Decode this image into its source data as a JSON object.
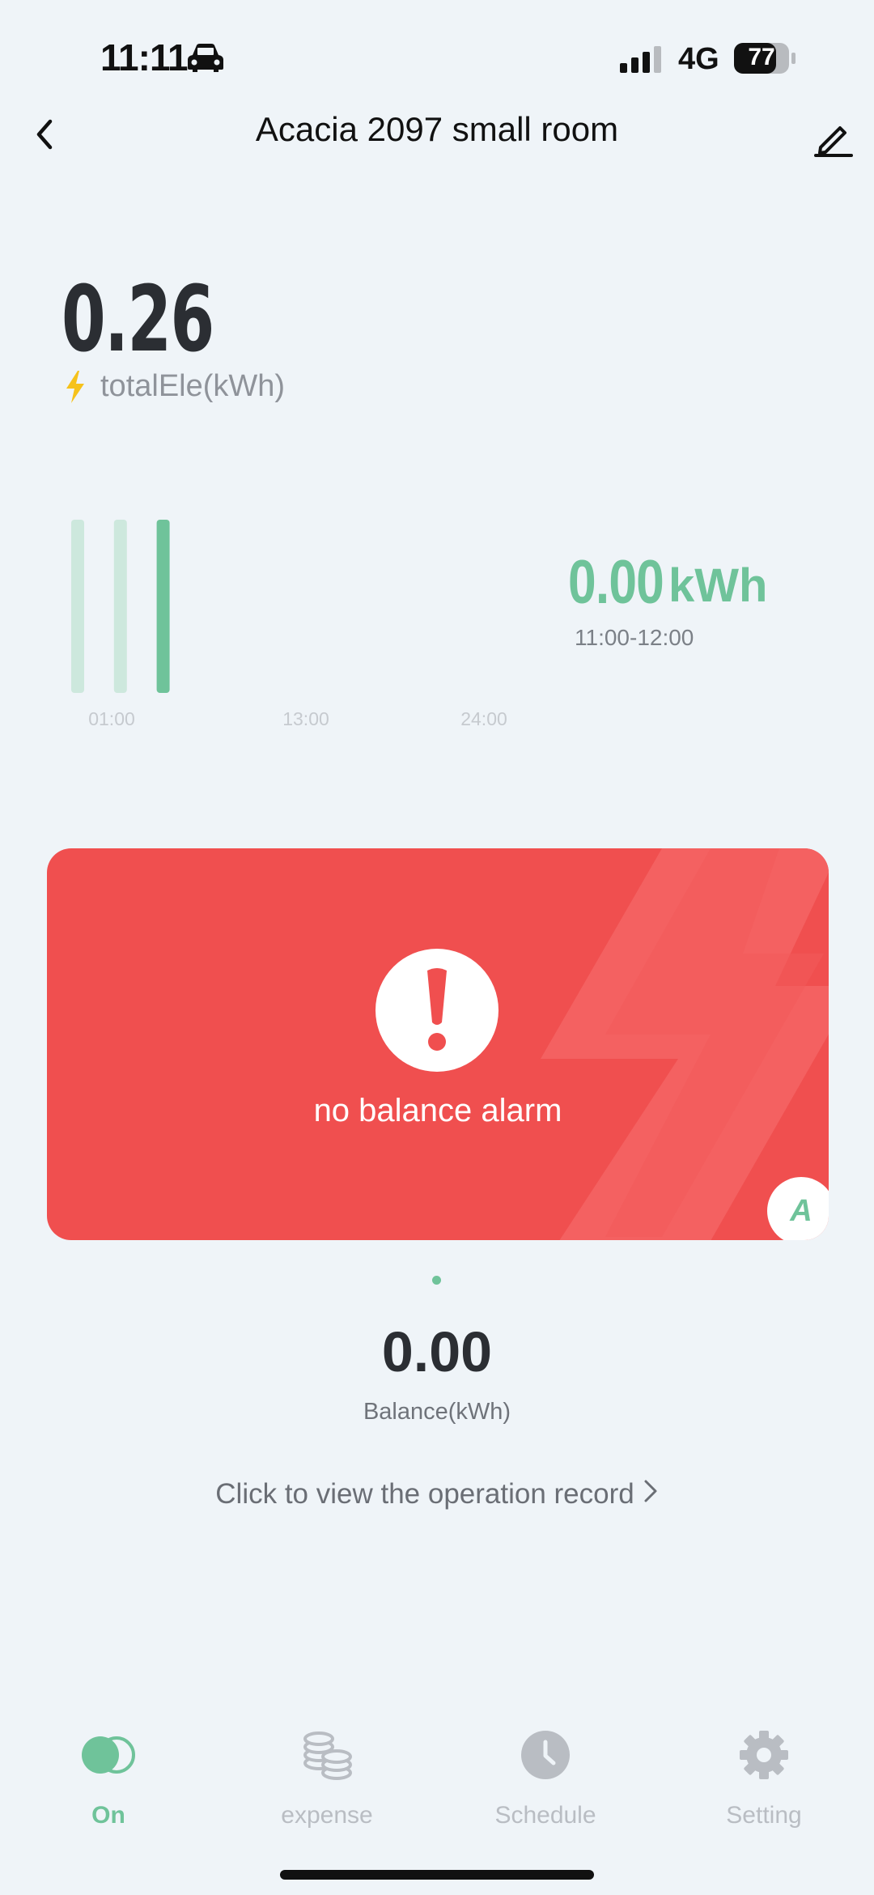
{
  "status_bar": {
    "time": "11:11",
    "network": "4G",
    "battery": "77"
  },
  "header": {
    "title": "Acacia 2097 small room"
  },
  "summary": {
    "total_value": "0.26",
    "total_label": "totalEle(kWh)"
  },
  "chart_data": {
    "type": "bar",
    "x_ticks": [
      "01:00",
      "13:00",
      "24:00"
    ],
    "bars": [
      {
        "hour": 1,
        "value": 0.13,
        "highlighted": false
      },
      {
        "hour": 2,
        "value": 0.13,
        "highlighted": false
      },
      {
        "hour": 3,
        "value": 0.13,
        "highlighted": true
      }
    ],
    "ylim": [
      0,
      0.13
    ],
    "selected": {
      "value": "0.00",
      "unit": "kWh",
      "range": "11:00-12:00"
    },
    "colors": {
      "light": "#cde8dd",
      "highlight": "#6fc39a"
    }
  },
  "alarm": {
    "text": "no balance alarm",
    "badge": "A",
    "color": "#f04f4f"
  },
  "balance": {
    "value": "0.00",
    "label": "Balance(kWh)"
  },
  "record_link": {
    "text": "Click to view the operation record"
  },
  "nav": {
    "items": [
      {
        "label": "On",
        "icon": "toggle-icon",
        "active": true
      },
      {
        "label": "expense",
        "icon": "coins-icon",
        "active": false
      },
      {
        "label": "Schedule",
        "icon": "clock-icon",
        "active": false
      },
      {
        "label": "Setting",
        "icon": "gear-icon",
        "active": false
      }
    ],
    "active_color": "#6fc39a",
    "inactive_color": "#b9bdc3"
  }
}
